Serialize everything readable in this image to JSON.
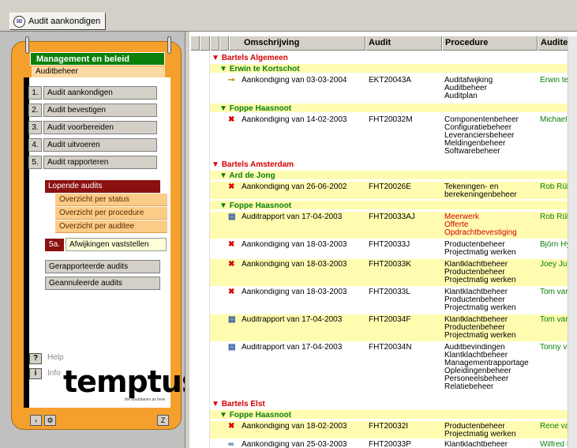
{
  "toolbar": {
    "announce_button": "Audit aankondigen"
  },
  "panel": {
    "header": "Management en beleid",
    "subheader": "Auditbeheer",
    "steps": [
      {
        "num": "1.",
        "label": "Audit aankondigen"
      },
      {
        "num": "2.",
        "label": "Audit bevestigen"
      },
      {
        "num": "3.",
        "label": "Audit voorbereiden"
      },
      {
        "num": "4.",
        "label": "Audit uitvoeren"
      },
      {
        "num": "5.",
        "label": "Audit rapporteren"
      }
    ],
    "lopende": "Lopende audits",
    "overview_options": [
      "Overzicht per status",
      "Overzicht per procedure",
      "Overzicht per auditee"
    ],
    "deviation_num": "5a.",
    "deviation_label": "Afwijkingen vaststellen",
    "reported": "Gerapporteerde audits",
    "cancelled": "Geannuleerde audits",
    "help": "Help",
    "info": "Info",
    "help_key": "?",
    "info_key": "i",
    "logo": "temptus",
    "logo_tagline": "the boundaries as here",
    "colors": {
      "panel": "#f5a02d",
      "header": "#0a7f0a",
      "active": "#8b1111"
    }
  },
  "grid": {
    "columns": [
      "Omschrijving",
      "Audit",
      "Procedure",
      "Auditee"
    ],
    "groups": {
      "g1": "Bartels Algemeen",
      "g1a": "Erwin te Kortschot",
      "g1b": "Foppe Haasnoot",
      "g2": "Bartels Amsterdam",
      "g2a": "Ard de Jong",
      "g2b": "Foppe Haasnoot",
      "g3": "Bartels Elst",
      "g3a": "Foppe Haasnoot"
    },
    "rows": [
      {
        "icon": "key-icon",
        "desc": "Aankondiging van 03-03-2004",
        "audit": "EKT20043A",
        "proc": [
          "Auditafwijking",
          "Auditbeheer",
          "Auditplan"
        ],
        "auditee": "Erwin te"
      },
      {
        "icon": "cross-icon",
        "desc": "Aankondiging van 14-02-2003",
        "audit": "FHT20032M",
        "proc": [
          "Componentenbeheer",
          "Configuratiebeheer",
          "Leveranciersbeheer",
          "Meldingenbeheer",
          "Softwarebeheer"
        ],
        "auditee": "Michael"
      },
      {
        "icon": "cross-icon",
        "desc": "Aankondiging van 26-06-2002",
        "audit": "FHT20026E",
        "proc": [
          "Tekeningen- en",
          "berekeningenbeheer"
        ],
        "auditee": "Rob Rük"
      },
      {
        "icon": "report-icon",
        "desc": "Auditrapport van 17-04-2003",
        "audit": "FHT20033AJ",
        "proc": [
          "Meerwerk",
          "Offerte",
          "Opdrachtbevestiging"
        ],
        "auditee": "Rob Rük"
      },
      {
        "icon": "cross-icon",
        "desc": "Aankondiging van 18-03-2003",
        "audit": "FHT20033J",
        "proc": [
          "Productenbeheer",
          "Projectmatig werken"
        ],
        "auditee": "Björn Hy"
      },
      {
        "icon": "cross-icon",
        "desc": "Aankondiging van 18-03-2003",
        "audit": "FHT20033K",
        "proc": [
          "Klantklachtbeheer",
          "Productenbeheer",
          "Projectmatig werken"
        ],
        "auditee": "Joey Juf"
      },
      {
        "icon": "cross-icon",
        "desc": "Aankondiging van 18-03-2003",
        "audit": "FHT20033L",
        "proc": [
          "Klantklachtbeheer",
          "Productenbeheer",
          "Projectmatig werken"
        ],
        "auditee": "Tom var"
      },
      {
        "icon": "report-icon",
        "desc": "Auditrapport van 17-04-2003",
        "audit": "FHT20034F",
        "proc": [
          "Klantklachtbeheer",
          "Productenbeheer",
          "Projectmatig werken"
        ],
        "auditee": "Tom var"
      },
      {
        "icon": "report-icon",
        "desc": "Auditrapport van 17-04-2003",
        "audit": "FHT20034N",
        "proc": [
          "Auditbevindingen",
          "Klantklachtbeheer",
          "Managementrapportage",
          "Opleidingenbeheer",
          "Personeelsbeheer",
          "Relatiebeheer"
        ],
        "auditee": "Tonny v"
      },
      {
        "icon": "cross-icon",
        "desc": "Aankondiging van 18-02-2003",
        "audit": "FHT20032I",
        "proc": [
          "Productenbeheer",
          "Projectmatig werken"
        ],
        "auditee": "Rene va"
      },
      {
        "icon": "glasses-icon",
        "desc": "Aankondiging van 25-03-2003",
        "audit": "FHT20033P",
        "proc": [
          "Klantklachtbeheer"
        ],
        "auditee": "Wilfred K"
      }
    ]
  }
}
